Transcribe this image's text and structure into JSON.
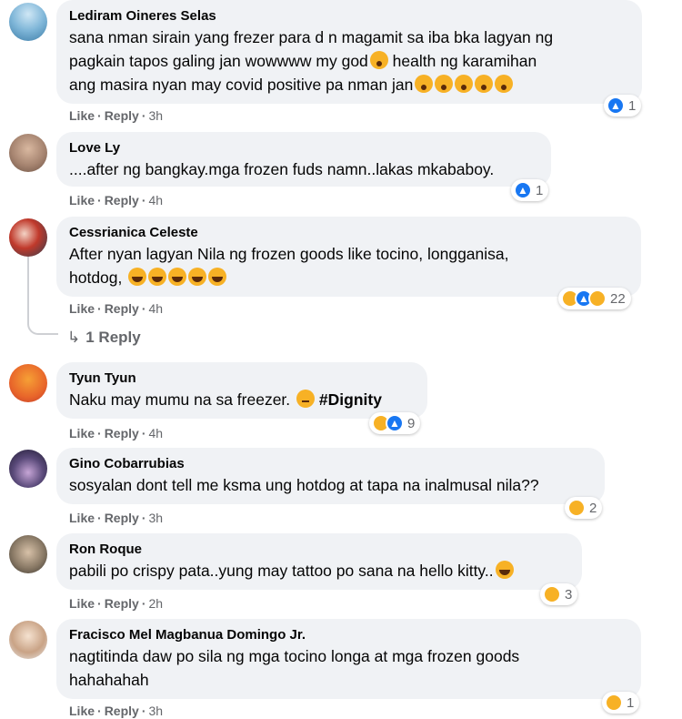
{
  "comments": [
    {
      "author": "Lediram Oineres Selas",
      "lines": [
        "sana nman sirain yang frezer para d n magamit sa iba bka lagyan ng",
        "pagkain tapos galing jan wowwww my god",
        " health ng karamihan",
        "ang masira nyan may covid positive pa nman jan"
      ],
      "like": "Like",
      "reply": "Reply",
      "time": "3h",
      "reaction_count": "1"
    },
    {
      "author": "Love Ly",
      "text": "....after ng bangkay.mga frozen fuds namn..lakas mkababoy.",
      "like": "Like",
      "reply": "Reply",
      "time": "4h",
      "reaction_count": "1"
    },
    {
      "author": "Cessrianica Celeste",
      "lines": [
        "After nyan lagyan Nila ng frozen goods like tocino, longganisa,",
        "hotdog,"
      ],
      "like": "Like",
      "reply": "Reply",
      "time": "4h",
      "reaction_count": "22",
      "replies_label": "1 Reply"
    },
    {
      "author": "Tyun Tyun",
      "text": "Naku may mumu na sa freezer.",
      "hashtag": "#Dignity",
      "like": "Like",
      "reply": "Reply",
      "time": "4h",
      "reaction_count": "9"
    },
    {
      "author": "Gino Cobarrubias",
      "text": "sosyalan dont tell me ksma ung hotdog at tapa na inalmusal nila??",
      "like": "Like",
      "reply": "Reply",
      "time": "3h",
      "reaction_count": "2"
    },
    {
      "author": "Ron Roque",
      "text": "pabili po crispy pata..yung may tattoo po sana na hello kitty..",
      "like": "Like",
      "reply": "Reply",
      "time": "2h",
      "reaction_count": "3"
    },
    {
      "author": "Fracisco Mel Magbanua Domingo Jr.",
      "lines": [
        "nagtitinda daw po sila ng mga tocino longa at mga frozen goods",
        "hahahahah"
      ],
      "like": "Like",
      "reply": "Reply",
      "time": "3h",
      "reaction_count": "1"
    }
  ],
  "separator": "·",
  "reply_arrow": "↳",
  "colors": {
    "bubble": "#f0f2f5",
    "meta": "#65676b",
    "like_blue": "#1877f2",
    "emoji_yellow": "#f7b125"
  }
}
